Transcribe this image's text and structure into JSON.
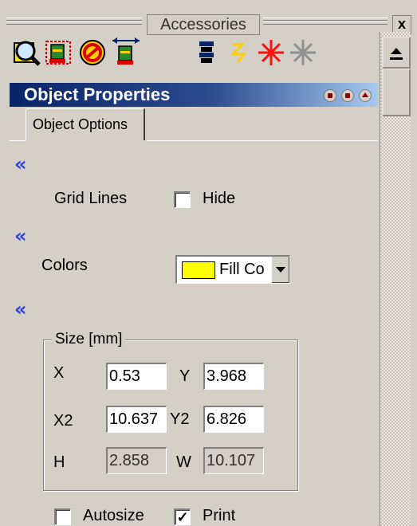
{
  "window": {
    "title": "Accessories",
    "close_label": "x"
  },
  "toolbar": {
    "icons": [
      "zoom-icon",
      "select-stencil-icon",
      "no-entry-icon",
      "resize-stencil-icon",
      "stack-icon",
      "lightning-icon",
      "red-spark-icon",
      "gray-spark-icon"
    ]
  },
  "panel": {
    "title": "Object Properties",
    "tab_label": "Object Options"
  },
  "sections": {
    "collapse_glyph": "«",
    "grid": {
      "label": "Grid Lines",
      "checkbox_label": "Hide",
      "checked": false
    },
    "colors": {
      "label": "Colors",
      "combo_value": "Fill Co",
      "swatch_color": "#ffff00"
    },
    "size": {
      "legend": "Size [mm]",
      "x_label": "X",
      "x_value": "0.53",
      "y_label": "Y",
      "y_value": "3.968",
      "x2_label": "X2",
      "x2_value": "10.637",
      "y2_label": "Y2",
      "y2_value": "6.826",
      "h_label": "H",
      "h_value": "2.858",
      "w_label": "W",
      "w_value": "10.107"
    },
    "options": {
      "autosize_label": "Autosize",
      "autosize_checked": false,
      "print_label": "Print",
      "print_checked": true,
      "check_glyph": "✓"
    }
  },
  "colors": {
    "header_start": "#0a246a",
    "header_end": "#a6caf0",
    "collapse_arrow": "#2c3ee0",
    "chrome": "#d4d0c8"
  }
}
